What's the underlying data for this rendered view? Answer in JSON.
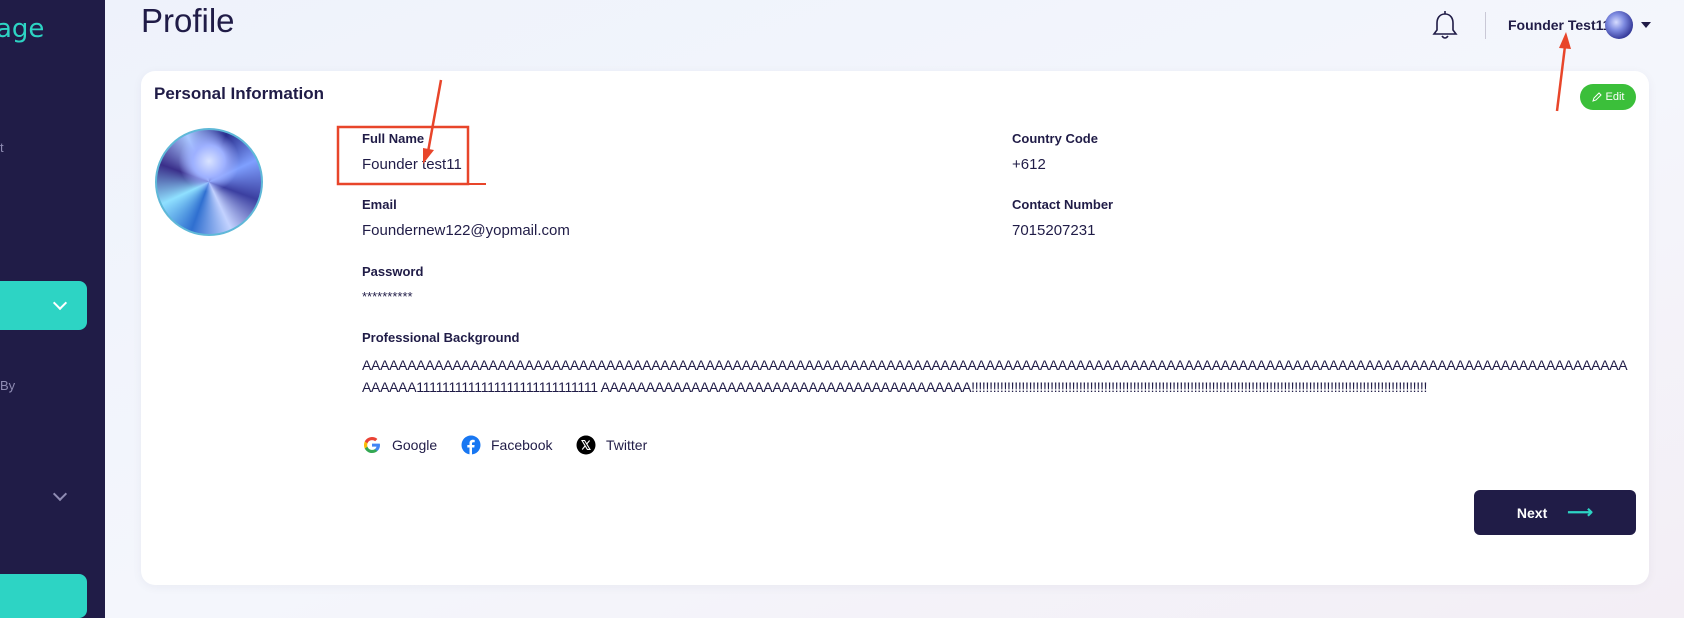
{
  "sidebar": {
    "logo_fragment": "age",
    "fragment_1": "t",
    "fragment_2": "By"
  },
  "header": {
    "title": "Profile",
    "user_name": "Founder Test11"
  },
  "card": {
    "title": "Personal Information",
    "edit_label": "Edit"
  },
  "fields": {
    "full_name_label": "Full Name",
    "full_name_value": "Founder test11",
    "country_code_label": "Country Code",
    "country_code_value": "+612",
    "email_label": "Email",
    "email_value": "Foundernew122@yopmail.com",
    "contact_label": "Contact Number",
    "contact_value": "7015207231",
    "password_label": "Password",
    "password_value": "**********",
    "background_label": "Professional Background",
    "background_value": "AAAAAAAAAAAAAAAAAAAAAAAAAAAAAAAAAAAAAAAAAAAAAAAAAAAAAAAAAAAAAAAAAAAAAAAAAAAAAAAAAAAAAAAAAAAAAAAAAAAAAAAAAAAAAAAAAAAAAAAAAAAAAAAAAAAAAAAAAAAAAAAAAA1111111111111111111111111111 AAAAAAAAAAAAAAAAAAAAAAAAAAAAAAAAAAAAAAAAA!!!!!!!!!!!!!!!!!!!!!!!!!!!!!!!!!!!!!!!!!!!!!!!!!!!!!!!!!!!!!!!!!!!!!!!!!!!!!!!!!!!!!!!!!!!!!!!!!!!!!!!!!!!!!!!!!!!!!!!!!!!!!!!"
  },
  "social": {
    "google": "Google",
    "facebook": "Facebook",
    "twitter": "Twitter"
  },
  "actions": {
    "next_label": "Next"
  },
  "colors": {
    "sidebar_bg": "#201c47",
    "accent_teal": "#2dd4c4",
    "edit_green": "#3bbf3a",
    "annotation_red": "#e8452a"
  }
}
